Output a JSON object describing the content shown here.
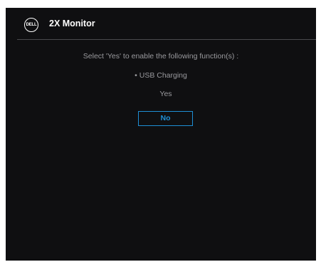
{
  "header": {
    "logo_text": "DELL",
    "title": "2X Monitor"
  },
  "dialog": {
    "message": "Select 'Yes' to enable the following function(s) :",
    "function_item": "• USB Charging",
    "options": {
      "yes_label": "Yes",
      "no_label": "No",
      "selected": "No"
    }
  },
  "colors": {
    "background": "#0f0f11",
    "accent": "#1e8fd6",
    "text": "#9a9a9e",
    "title": "#ffffff"
  }
}
